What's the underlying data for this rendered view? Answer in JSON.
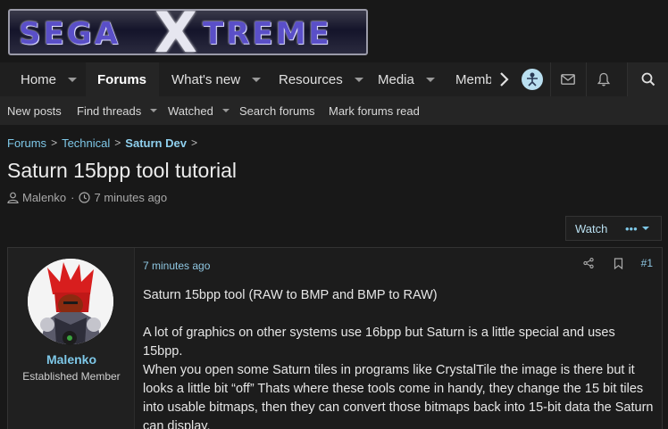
{
  "site": {
    "logo_left": "SEGA",
    "logo_x": "X",
    "logo_right": "TREME"
  },
  "nav": {
    "items": [
      {
        "label": "Home",
        "active": false,
        "caret": true
      },
      {
        "label": "Forums",
        "active": true,
        "caret": false
      },
      {
        "label": "What's new",
        "active": false,
        "caret": true
      },
      {
        "label": "Resources",
        "active": false,
        "caret": true
      },
      {
        "label": "Media",
        "active": false,
        "caret": true
      },
      {
        "label": "Memb",
        "active": false,
        "caret": false
      }
    ],
    "icons": [
      "chevron-right-icon",
      "user-avatar-icon",
      "envelope-icon",
      "bell-icon",
      "search-icon"
    ]
  },
  "subnav": {
    "items": [
      {
        "label": "New posts",
        "caret": false
      },
      {
        "label": "Find threads",
        "caret": true
      },
      {
        "label": "Watched",
        "caret": true
      },
      {
        "label": "Search forums",
        "caret": false
      },
      {
        "label": "Mark forums read",
        "caret": false
      }
    ]
  },
  "breadcrumb": [
    "Forums",
    "Technical",
    "Saturn Dev"
  ],
  "thread": {
    "title": "Saturn 15bpp tool tutorial",
    "author": "Malenko",
    "time": "7 minutes ago",
    "watch_label": "Watch",
    "more_label": "•••"
  },
  "post": {
    "username": "Malenko",
    "user_title": "Established Member",
    "date": "7 minutes ago",
    "number": "#1",
    "paragraphs": [
      "Saturn 15bpp tool (RAW to BMP and BMP to RAW)",
      "A lot of graphics on other systems use 16bpp but Saturn is a little special and uses 15bpp.",
      "When you open some Saturn tiles in programs like CrystalTile the image is there but it looks a little bit “off” Thats where these tools come in handy, they change the 15 bit tiles into usable bitmaps, then they can convert those bitmaps back into 15-bit data the Saturn can display."
    ]
  },
  "colors": {
    "accent": "#7ec8e8",
    "background": "#181818",
    "online": "#3aa23e"
  }
}
